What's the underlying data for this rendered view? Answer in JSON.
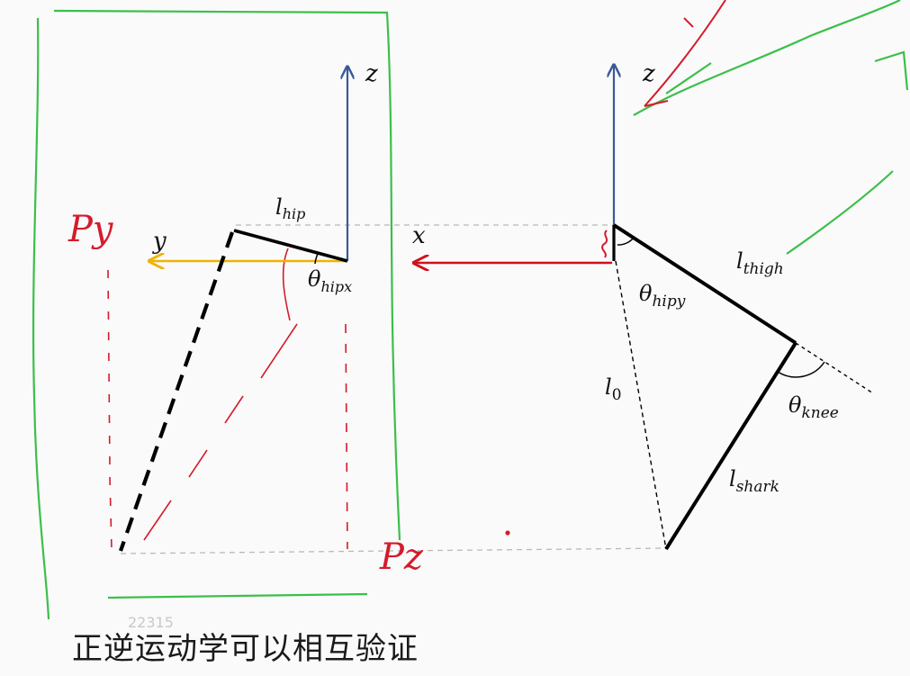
{
  "caption": "正逆运动学可以相互验证",
  "faint_id": "22315",
  "labels": {
    "z_left": "z",
    "z_right": "z",
    "y_axis": "y",
    "x_axis": "x",
    "l_hip_main": "l",
    "l_hip_sub": "hip",
    "theta_hipx_main": "θ",
    "theta_hipx_sub": "hipx",
    "l_thigh_main": "l",
    "l_thigh_sub": "thigh",
    "theta_hipy_main": "θ",
    "theta_hipy_sub": "hipy",
    "l0_main": "l",
    "l0_sub": "0",
    "theta_knee_main": "θ",
    "theta_knee_sub": "knee",
    "l_shark_main": "l",
    "l_shark_sub": "shark"
  },
  "handwriting": {
    "py": "Py",
    "pz": "Pz"
  },
  "colors": {
    "z_axis": "#3b5998",
    "y_axis": "#f0b400",
    "x_axis": "#d0101a",
    "links": "#000000",
    "red_ink": "#d41b2c",
    "green_ink": "#3cbf4a",
    "dashed_guides": "#b9b9b9"
  }
}
